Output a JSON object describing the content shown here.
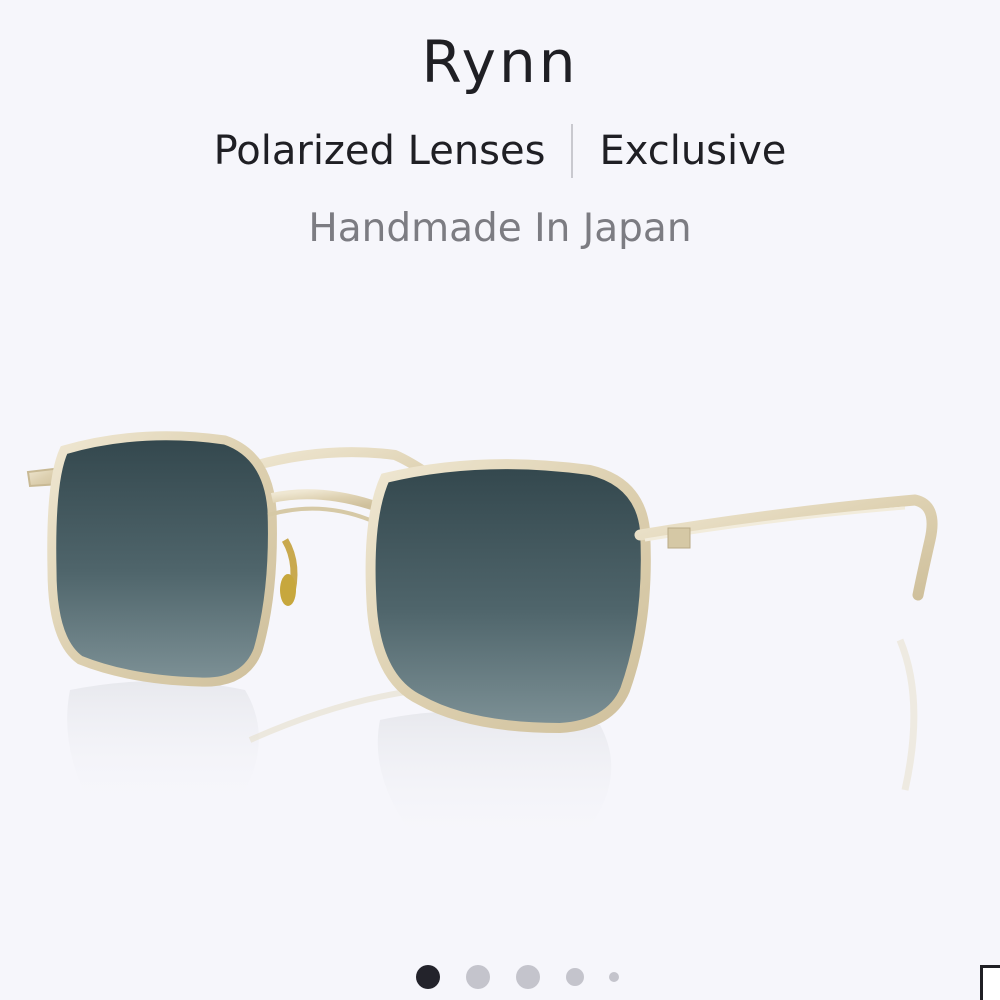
{
  "product": {
    "name": "Rynn",
    "tags": [
      "Polarized Lenses",
      "Exclusive"
    ],
    "origin": "Handmade In Japan"
  },
  "gallery": {
    "total_images": 5,
    "active_index": 0,
    "image_icon": "sunglasses-product-photo"
  },
  "colors": {
    "background": "#f6f6fb",
    "frame_gold": "#e3d8bc",
    "lens_top": "#33474d",
    "lens_bottom": "#7d9196",
    "dot_active": "#23232b",
    "dot_inactive": "#c4c4cc"
  }
}
